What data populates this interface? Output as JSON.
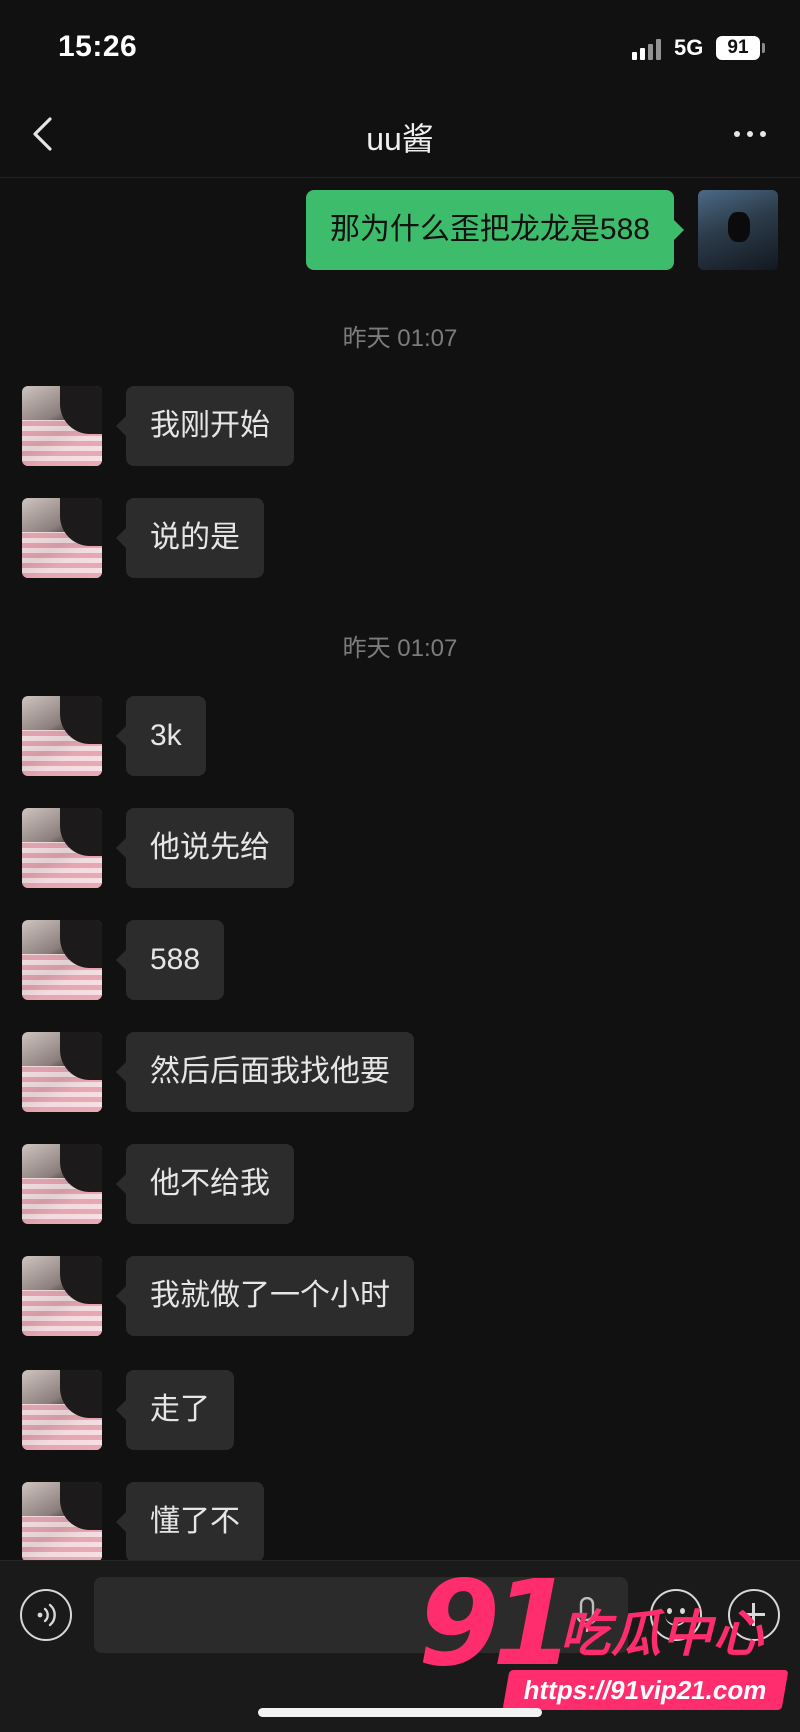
{
  "status_bar": {
    "time": "15:26",
    "network": "5G",
    "battery": "91"
  },
  "nav": {
    "title": "uu酱"
  },
  "messages": {
    "m0": "那为什么歪把龙龙是588",
    "t1": "昨天 01:07",
    "m1": "我刚开始",
    "m2": "说的是",
    "t2": "昨天 01:07",
    "m3": "3k",
    "m4": "他说先给",
    "m5": "588",
    "m6": "然后后面我找他要",
    "m7": "他不给我",
    "m8": "我就做了一个小时",
    "m9": "走了",
    "m10": "懂了不"
  },
  "input": {
    "value": "",
    "placeholder": ""
  },
  "icons": [
    "chevron-left-icon",
    "more-icon",
    "voice-icon",
    "microphone-icon",
    "emoji-icon",
    "plus-icon",
    "signal-icon",
    "battery-icon"
  ],
  "watermark": {
    "number": "91",
    "text": "吃瓜中心",
    "url": "https://91vip21.com"
  },
  "colors": {
    "background": "#111111",
    "outgoing_bubble": "#3dbd6c",
    "incoming_bubble": "#2c2c2c",
    "watermark": "#ff2d6e"
  }
}
